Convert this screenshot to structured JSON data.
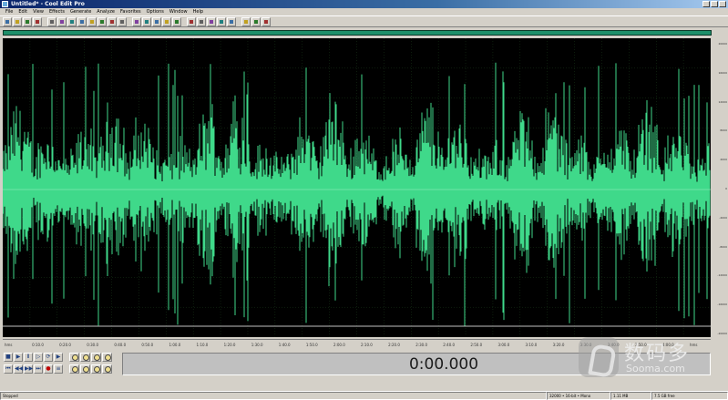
{
  "window": {
    "title": "Untitled* - Cool Edit Pro"
  },
  "menu": [
    "File",
    "Edit",
    "View",
    "Effects",
    "Generate",
    "Analyze",
    "Favorites",
    "Options",
    "Window",
    "Help"
  ],
  "toolbar": {
    "icons": [
      "new-icon",
      "open-icon",
      "save-icon",
      "save-all-icon",
      "cut-icon",
      "copy-icon",
      "paste-icon",
      "paste-new-icon",
      "mix-paste-icon",
      "trim-icon",
      "delete-icon",
      "undo-icon",
      "redo-icon",
      "repeat-icon",
      "marker-icon",
      "cue-list-icon",
      "play-list-icon",
      "info-icon",
      "spectral-view-icon",
      "waveform-view-icon",
      "multitrack-icon",
      "frequency-icon",
      "scripts-icon",
      "settings-icon",
      "help-icon"
    ]
  },
  "colors": {
    "waveform": "#3fd98a",
    "background": "#000000",
    "overview": "#1e8f6a"
  },
  "ruler_right": [
    "20000",
    "16000",
    "12000",
    "8000",
    "4000",
    "0",
    "-4000",
    "-8000",
    "-12000",
    "-16000",
    "-20000"
  ],
  "timeline": [
    "hms",
    "0:10.0",
    "0:20.0",
    "0:30.0",
    "0:40.0",
    "0:50.0",
    "1:00.0",
    "1:10.0",
    "1:20.0",
    "1:30.0",
    "1:40.0",
    "1:50.0",
    "2:00.0",
    "2:10.0",
    "2:20.0",
    "2:30.0",
    "2:40.0",
    "2:50.0",
    "3:00.0",
    "3:10.0",
    "3:20.0",
    "3:30.0",
    "3:40.0",
    "3:50.0",
    "4:00.0",
    "hms"
  ],
  "transport": {
    "buttons": [
      "stop",
      "play",
      "pause",
      "play-from-cursor",
      "play-looped",
      "play-to-end",
      "go-to-start",
      "rewind",
      "fast-forward",
      "go-to-end",
      "record",
      "scroll"
    ]
  },
  "zoom": {
    "buttons": [
      "zoom-in",
      "zoom-out",
      "zoom-full",
      "zoom-selection",
      "zoom-left",
      "zoom-right",
      "zoom-in-vertical",
      "zoom-out-vertical"
    ]
  },
  "time_display": "0:00.000",
  "status": {
    "state": "Stopped",
    "format": "32000 • 16-bit • Mono",
    "size": "1.11 MB",
    "free": "7.5 GB free"
  },
  "watermark": {
    "text": "数码多",
    "subtext": "Sooma.com"
  }
}
